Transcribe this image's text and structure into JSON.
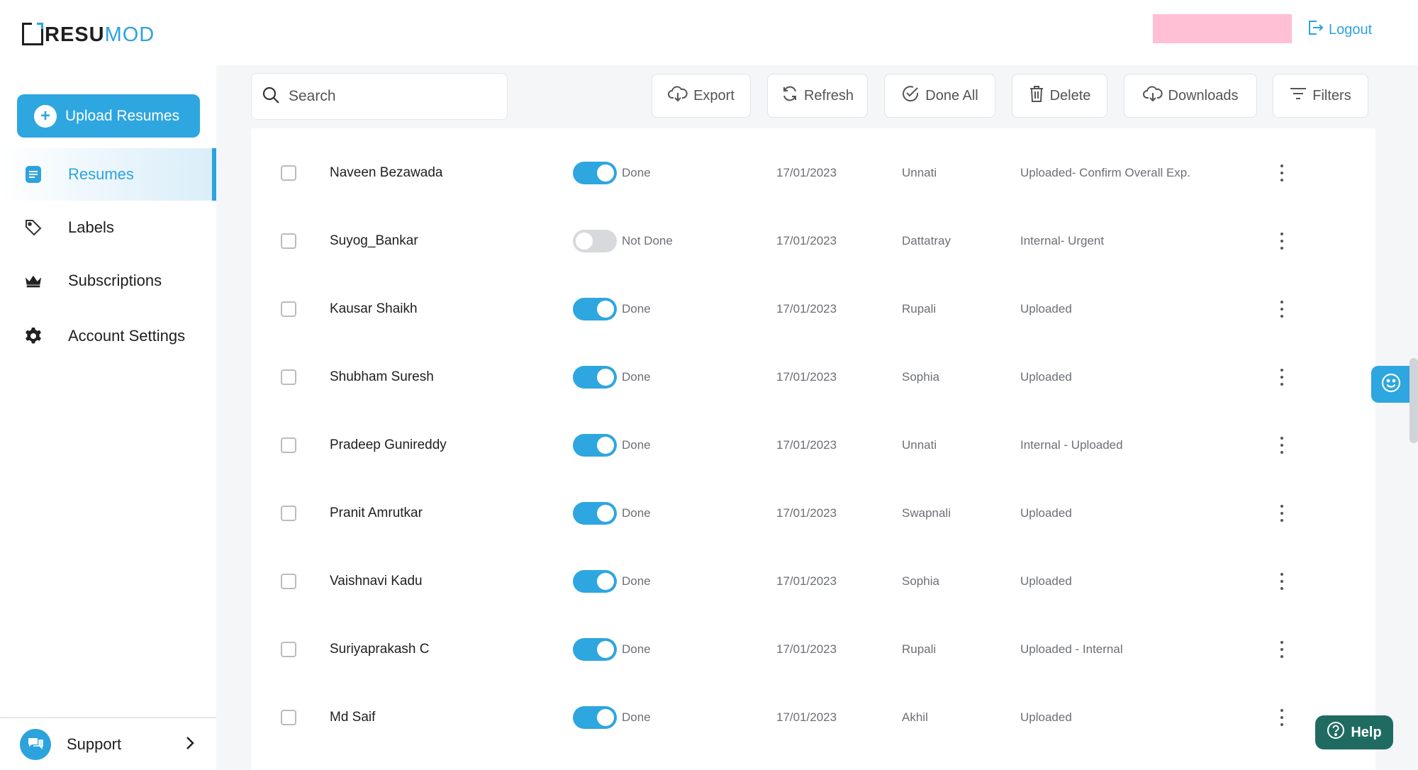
{
  "app": {
    "logo_part1": "RESU",
    "logo_part2": "MOD"
  },
  "header": {
    "logout_label": "Logout"
  },
  "sidebar": {
    "upload_label": "Upload Resumes",
    "items": [
      {
        "label": "Resumes",
        "icon": "document-icon",
        "active": true
      },
      {
        "label": "Labels",
        "icon": "tag-icon",
        "active": false
      },
      {
        "label": "Subscriptions",
        "icon": "crown-icon",
        "active": false
      },
      {
        "label": "Account Settings",
        "icon": "gear-icon",
        "active": false
      }
    ],
    "support_label": "Support"
  },
  "toolbar": {
    "search_placeholder": "Search",
    "export_label": "Export",
    "refresh_label": "Refresh",
    "done_all_label": "Done All",
    "delete_label": "Delete",
    "downloads_label": "Downloads",
    "filters_label": "Filters"
  },
  "rows": [
    {
      "name": "Naveen Bezawada",
      "done": true,
      "status": "Done",
      "date": "17/01/2023",
      "person": "Unnati",
      "label": "Uploaded- Confirm Overall Exp."
    },
    {
      "name": "Suyog_Bankar",
      "done": false,
      "status": "Not Done",
      "date": "17/01/2023",
      "person": "Dattatray",
      "label": "Internal- Urgent"
    },
    {
      "name": "Kausar Shaikh",
      "done": true,
      "status": "Done",
      "date": "17/01/2023",
      "person": "Rupali",
      "label": "Uploaded"
    },
    {
      "name": "Shubham Suresh",
      "done": true,
      "status": "Done",
      "date": "17/01/2023",
      "person": "Sophia",
      "label": "Uploaded"
    },
    {
      "name": "Pradeep Gunireddy",
      "done": true,
      "status": "Done",
      "date": "17/01/2023",
      "person": "Unnati",
      "label": "Internal - Uploaded"
    },
    {
      "name": "Pranit Amrutkar",
      "done": true,
      "status": "Done",
      "date": "17/01/2023",
      "person": "Swapnali",
      "label": "Uploaded"
    },
    {
      "name": "Vaishnavi Kadu",
      "done": true,
      "status": "Done",
      "date": "17/01/2023",
      "person": "Sophia",
      "label": "Uploaded"
    },
    {
      "name": "Suriyaprakash C",
      "done": true,
      "status": "Done",
      "date": "17/01/2023",
      "person": "Rupali",
      "label": "Uploaded - Internal"
    },
    {
      "name": "Md Saif",
      "done": true,
      "status": "Done",
      "date": "17/01/2023",
      "person": "Akhil",
      "label": "Uploaded"
    }
  ],
  "help": {
    "label": "Help"
  },
  "colors": {
    "accent": "#2da3dd",
    "toggle_off": "#d7d9dc",
    "help_bg": "#1f6b62",
    "redacted": "#ffbfd5"
  }
}
